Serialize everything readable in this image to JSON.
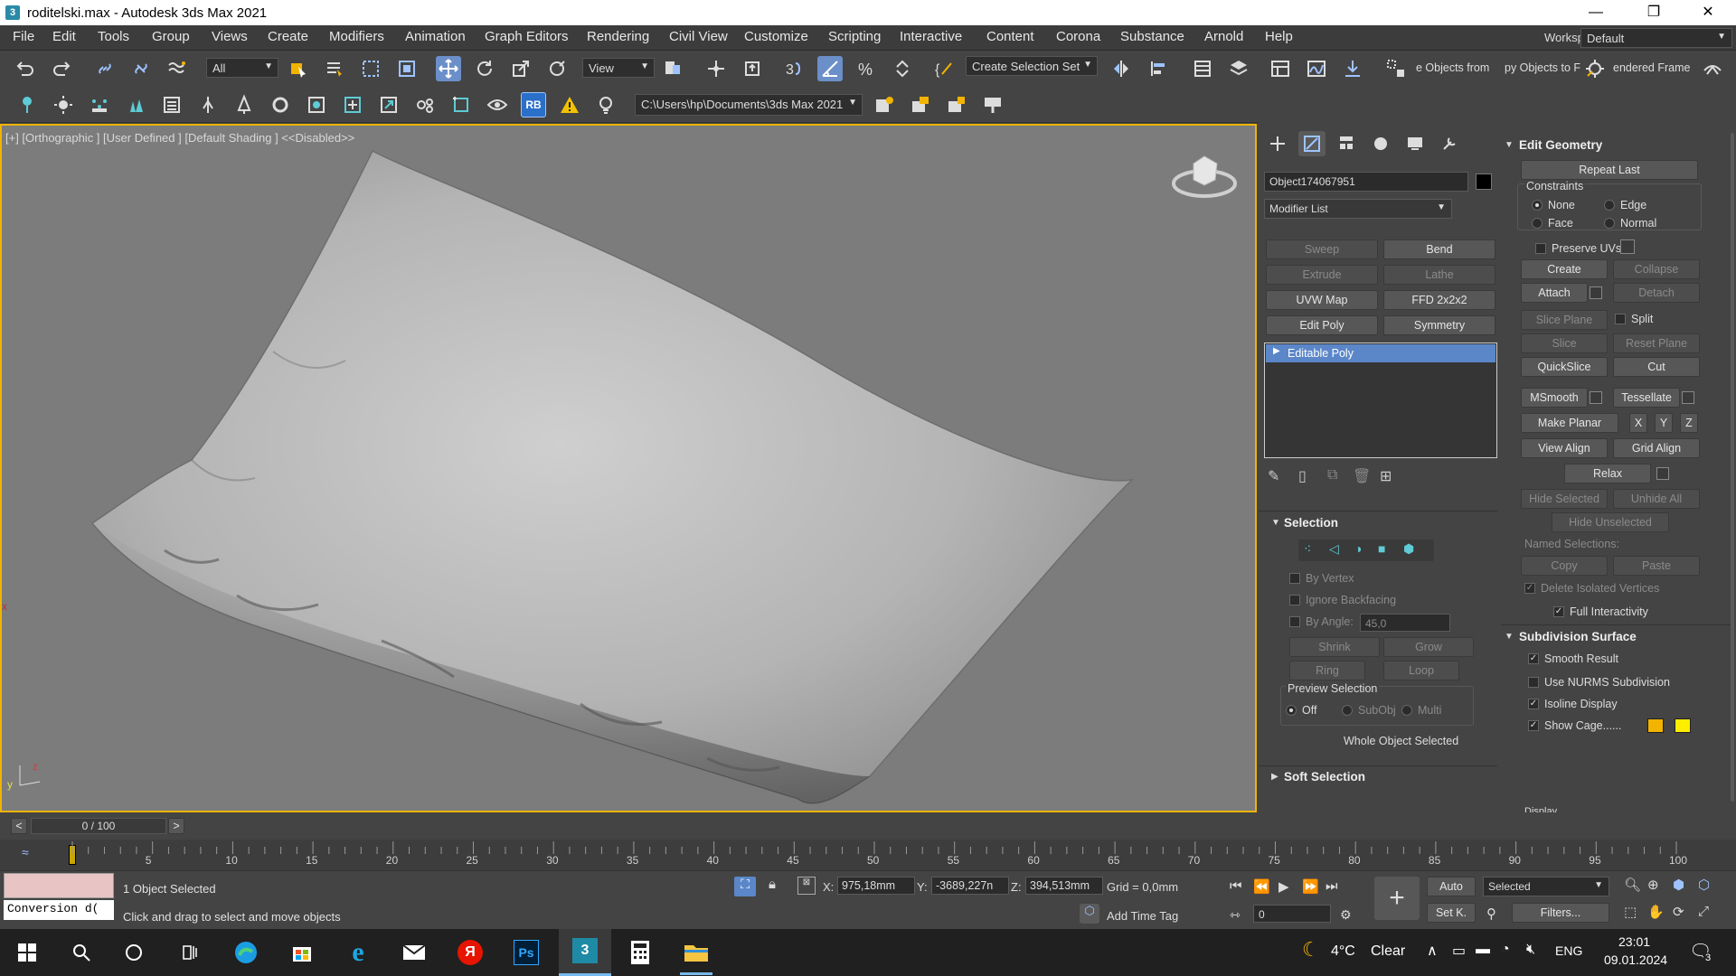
{
  "window": {
    "title": "roditelski.max - Autodesk 3ds Max 2021",
    "app_icon": "3",
    "minimize": "—",
    "maximize": "❐",
    "close": "✕"
  },
  "menu": {
    "items": [
      "File",
      "Edit",
      "Tools",
      "Group",
      "Views",
      "Create",
      "Modifiers",
      "Animation",
      "Graph Editors",
      "Rendering",
      "Civil View",
      "Customize",
      "Scripting",
      "Interactive",
      "Content",
      "Corona",
      "Substance",
      "Arnold",
      "Help"
    ],
    "workspaces_label": "Workspaces:",
    "workspace_value": "Default"
  },
  "toolbar1": {
    "filter_value": "All",
    "ref_coord_value": "View",
    "selection_set_value": "Create Selection Set",
    "objects_from_label": "e Objects from",
    "objects_to_label": "py Objects to F",
    "rendered_frame_label": "endered Frame"
  },
  "toolbar2": {
    "rb_label": "RB",
    "path_value": "C:\\Users\\hp\\Documents\\3ds Max 2021"
  },
  "viewport": {
    "label": "[+] [Orthographic ] [User Defined ] [Default Shading ]  <<Disabled>>",
    "axis_x": "x",
    "axis_y": "y",
    "axis_z": "z"
  },
  "command_panel": {
    "object_name": "Object174067951",
    "object_color": "#000000",
    "modifier_list": "Modifier List",
    "modifier_buttons": [
      "Sweep",
      "Bend",
      "Extrude",
      "Lathe",
      "UVW Map",
      "FFD 2x2x2",
      "Edit Poly",
      "Symmetry"
    ],
    "modifier_buttons_disabled": [
      true,
      false,
      true,
      true,
      false,
      false,
      false,
      false
    ],
    "stack_item": "Editable Poly",
    "selection": {
      "title": "Selection",
      "by_vertex": "By Vertex",
      "ignore_backfacing": "Ignore Backfacing",
      "by_angle": "By Angle:",
      "angle_value": "45,0",
      "shrink": "Shrink",
      "grow": "Grow",
      "ring": "Ring",
      "loop": "Loop",
      "preview_selection": "Preview Selection",
      "off": "Off",
      "subobj": "SubObj",
      "multi": "Multi",
      "status": "Whole Object Selected"
    },
    "soft_selection": {
      "title": "Soft Selection"
    },
    "edit_geometry": {
      "title": "Edit Geometry",
      "repeat_last": "Repeat Last",
      "constraints": "Constraints",
      "none": "None",
      "edge": "Edge",
      "face": "Face",
      "normal": "Normal",
      "preserve_uvs": "Preserve UVs",
      "create": "Create",
      "collapse": "Collapse",
      "attach": "Attach",
      "detach": "Detach",
      "slice_plane": "Slice Plane",
      "split": "Split",
      "slice": "Slice",
      "reset_plane": "Reset Plane",
      "quickslice": "QuickSlice",
      "cut": "Cut",
      "msmooth": "MSmooth",
      "tessellate": "Tessellate",
      "make_planar": "Make Planar",
      "x": "X",
      "y": "Y",
      "z": "Z",
      "view_align": "View Align",
      "grid_align": "Grid Align",
      "relax": "Relax",
      "hide_selected": "Hide Selected",
      "unhide_all": "Unhide All",
      "hide_unselected": "Hide Unselected",
      "named_selections": "Named Selections:",
      "copy": "Copy",
      "paste": "Paste",
      "delete_isolated": "Delete Isolated Vertices",
      "full_interactivity": "Full Interactivity"
    },
    "subdivision": {
      "title": "Subdivision Surface",
      "smooth_result": "Smooth Result",
      "use_nurms": "Use NURMS Subdivision",
      "isoline_display": "Isoline Display",
      "show_cage": "Show Cage......",
      "display": "Display",
      "cage_color1": "#f2b400",
      "cage_color2": "#ffee00"
    }
  },
  "timeline": {
    "frame_display": "0 / 100",
    "prev": "<",
    "next": ">",
    "ticks": [
      "5",
      "10",
      "15",
      "20",
      "25",
      "30",
      "35",
      "40",
      "45",
      "50",
      "55",
      "60",
      "65",
      "70",
      "75",
      "80",
      "85",
      "90",
      "95",
      "100"
    ]
  },
  "status": {
    "maxscript_text": "Conversion d(",
    "selected_count": "1 Object Selected",
    "prompt": "Click and drag to select and move objects",
    "x_label": "X:",
    "x_value": "975,18mm",
    "y_label": "Y:",
    "y_value": "-3689,227n",
    "z_label": "Z:",
    "z_value": "394,513mm",
    "grid": "Grid = 0,0mm",
    "add_time_tag": "Add Time Tag",
    "auto": "Auto",
    "set_key": "Set K.",
    "selected_dropdown": "Selected",
    "filters": "Filters...",
    "frame_value": "0"
  },
  "taskbar": {
    "weather_temp": "4°C",
    "weather_text": "Clear",
    "lang": "ENG",
    "time": "23:01",
    "date": "09.01.2024",
    "notification_count": "3",
    "ps_label": "Ps",
    "ya_label": "Я",
    "max_label": "3"
  }
}
